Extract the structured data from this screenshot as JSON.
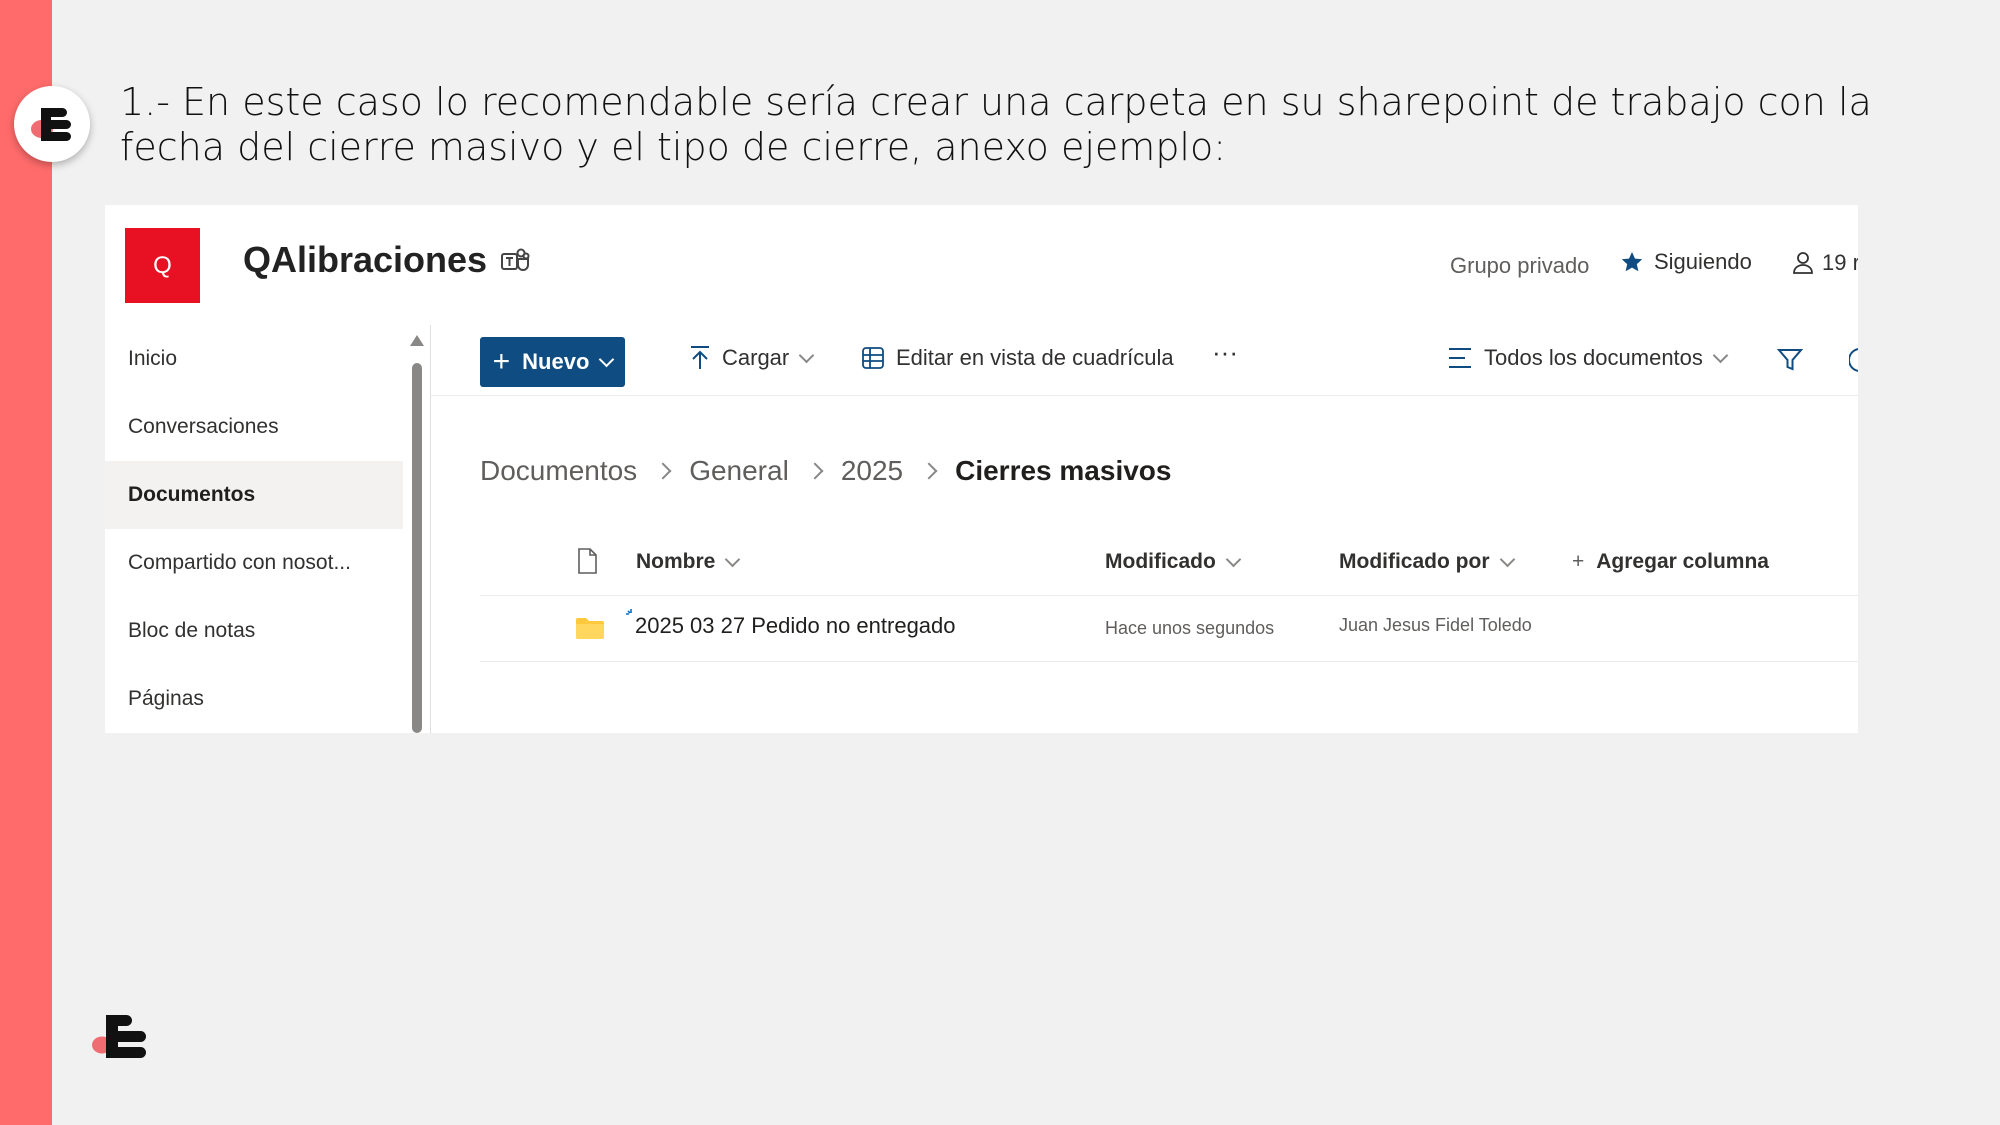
{
  "slide": {
    "heading": "1.- En este caso lo recomendable sería crear una carpeta en su sharepoint de trabajo con la fecha del cierre masivo y el tipo de cierre, anexo ejemplo:"
  },
  "site": {
    "logo_letter": "Q",
    "title": "QAlibraciones",
    "group_type": "Grupo privado",
    "follow_label": "Siguiendo",
    "members_label": "19 r"
  },
  "nav": {
    "items": [
      {
        "label": "Inicio"
      },
      {
        "label": "Conversaciones"
      },
      {
        "label": "Documentos"
      },
      {
        "label": "Compartido con nosot..."
      },
      {
        "label": "Bloc de notas"
      },
      {
        "label": "Páginas"
      }
    ],
    "active_index": 2
  },
  "commandbar": {
    "new_label": "Nuevo",
    "upload_label": "Cargar",
    "grid_edit_label": "Editar en vista de cuadrícula",
    "more_label": "···",
    "view_label": "Todos los documentos"
  },
  "breadcrumb": {
    "items": [
      "Documentos",
      "General",
      "2025"
    ],
    "current": "Cierres masivos"
  },
  "list": {
    "columns": {
      "name": "Nombre",
      "modified": "Modificado",
      "modified_by": "Modificado por",
      "add_column": "Agregar columna"
    },
    "rows": [
      {
        "name": "2025 03 27 Pedido no entregado",
        "modified": "Hace unos segundos",
        "modified_by": "Juan Jesus Fidel Toledo",
        "type": "folder-icon"
      }
    ]
  },
  "colors": {
    "side_bar": "#ff6b6b",
    "brand_pink": "#f06c73",
    "site_logo_bg": "#e81123",
    "primary_button": "#0f4c81",
    "folder": "#ffc83d"
  }
}
